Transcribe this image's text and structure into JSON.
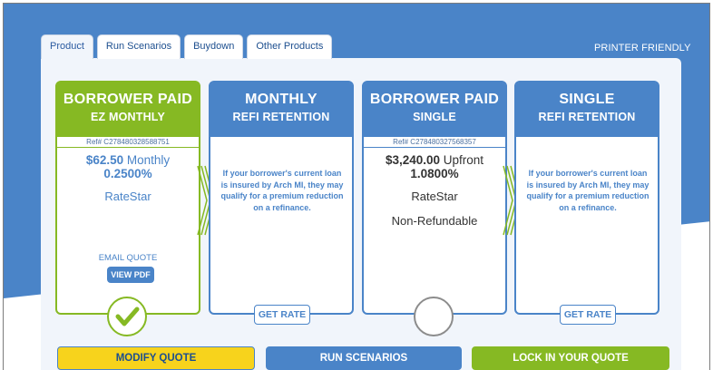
{
  "tabs": [
    {
      "label": "Product",
      "active": true
    },
    {
      "label": "Run Scenarios",
      "active": false
    },
    {
      "label": "Buydown",
      "active": false
    },
    {
      "label": "Other Products",
      "active": false
    }
  ],
  "printer_friendly": "PRINTER FRIENDLY",
  "cards": [
    {
      "title_line1": "BORROWER PAID",
      "title_line2": "EZ MONTHLY",
      "ref": "Ref# C278480328588751",
      "price": "$62.50",
      "price_suffix": " Monthly",
      "rate": "0.2500%",
      "brand": "RateStar",
      "email_quote": "EMAIL QUOTE",
      "view_pdf": "VIEW PDF",
      "selected": true
    },
    {
      "title_line1": "MONTHLY",
      "title_line2": "REFI RETENTION",
      "promo": "If your borrower's current loan is insured by Arch MI, they may qualify for a premium reduction on a refinance.",
      "get_rate": "GET RATE"
    },
    {
      "title_line1": "BORROWER PAID",
      "title_line2": "SINGLE",
      "ref": "Ref# C278480327568357",
      "price": "$3,240.00",
      "price_suffix": " Upfront",
      "rate": "1.0800%",
      "brand": "RateStar",
      "refundability": "Non-Refundable",
      "selected": false
    },
    {
      "title_line1": "SINGLE",
      "title_line2": "REFI RETENTION",
      "promo": "If your borrower's current loan is insured by Arch MI, they may qualify for a premium reduction on a refinance.",
      "get_rate": "GET RATE"
    }
  ],
  "actions": {
    "modify": "MODIFY QUOTE",
    "run": "RUN SCENARIOS",
    "lock": "LOCK IN YOUR QUOTE"
  },
  "colors": {
    "brand_blue": "#4a84c8",
    "brand_green": "#86b923",
    "modify_yellow": "#f7d31c",
    "unselected_gray": "#8c8c8c"
  },
  "icons": [
    "check-icon",
    "chevron-right-icon"
  ]
}
